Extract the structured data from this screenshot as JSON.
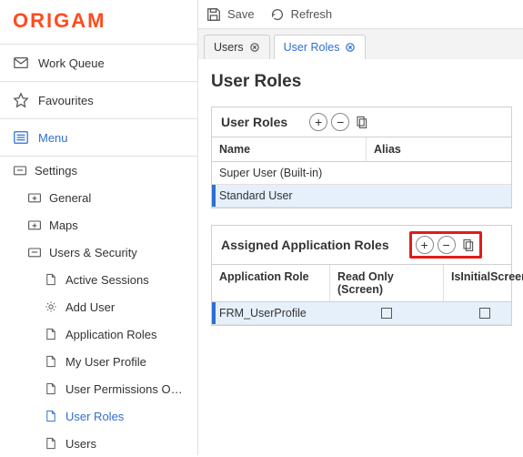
{
  "brand": "ORIGAM",
  "toolbar": {
    "save": "Save",
    "refresh": "Refresh"
  },
  "tabs": [
    {
      "label": "Users",
      "active": false
    },
    {
      "label": "User Roles",
      "active": true
    }
  ],
  "sidebar": {
    "work_queue": "Work Queue",
    "favourites": "Favourites",
    "menu": "Menu",
    "settings": "Settings",
    "general": "General",
    "maps": "Maps",
    "users_security": "Users & Security",
    "children": {
      "active_sessions": "Active Sessions",
      "add_user": "Add User",
      "application_roles": "Application Roles",
      "my_user_profile": "My User Profile",
      "user_permissions": "User Permissions Overv…",
      "user_roles": "User Roles",
      "users": "Users"
    }
  },
  "page": {
    "title": "User Roles",
    "roles_panel": {
      "title": "User Roles",
      "cols": {
        "name": "Name",
        "alias": "Alias"
      },
      "rows": [
        {
          "name": "Super User (Built-in)",
          "alias": ""
        },
        {
          "name": "Standard User",
          "alias": ""
        }
      ]
    },
    "assigned_panel": {
      "title": "Assigned Application Roles",
      "cols": {
        "role": "Application Role",
        "ro": "Read Only (Screen)",
        "init": "IsInitialScreen"
      },
      "rows": [
        {
          "role": "FRM_UserProfile",
          "ro": false,
          "init": false
        }
      ]
    }
  }
}
